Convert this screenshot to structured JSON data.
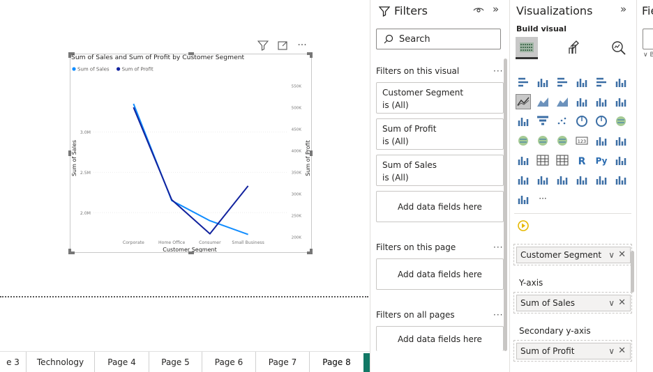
{
  "canvas": {
    "visual": {
      "title": "Sum of Sales and Sum of Profit by Customer Segment",
      "header_icons": [
        "filter-icon",
        "focus-mode-icon",
        "more-options-icon"
      ],
      "more_label": "···"
    }
  },
  "chart_data": {
    "type": "line",
    "title": "Sum of Sales and Sum of Profit by Customer Segment",
    "categories": [
      "Corporate",
      "Home Office",
      "Consumer",
      "Small Business"
    ],
    "xlabel": "Customer Segment",
    "ylabel": "Sum of Sales",
    "y2label": "Sum of Profit",
    "y_ticks": [
      "2.0M",
      "2.5M",
      "3.0M"
    ],
    "y2_ticks": [
      "200K",
      "250K",
      "300K",
      "350K",
      "400K",
      "450K",
      "500K",
      "550K"
    ],
    "ylim": [
      1700000,
      3600000
    ],
    "y2lim": [
      200000,
      555000
    ],
    "legend_position": "top-left",
    "series": [
      {
        "name": "Sum of Sales",
        "axis": "primary",
        "color": "#118dff",
        "values": [
          3350000,
          2150000,
          1900000,
          1730000
        ]
      },
      {
        "name": "Sum of Profit",
        "axis": "secondary",
        "color": "#12239e",
        "values": [
          500000,
          286000,
          207000,
          318000
        ]
      }
    ]
  },
  "tabs": {
    "items": [
      "e 3",
      "Technology",
      "Page 4",
      "Page 5",
      "Page 6",
      "Page 7",
      "Page 8"
    ],
    "active": "Page 8",
    "add_label": "+"
  },
  "filters": {
    "title": "Filters",
    "search_placeholder": "Search",
    "on_visual_label": "Filters on this visual",
    "on_page_label": "Filters on this page",
    "on_all_label": "Filters on all pages",
    "dots": "···",
    "cards": [
      {
        "name": "Customer Segment",
        "state": "is (All)"
      },
      {
        "name": "Sum of Profit",
        "state": "is (All)"
      },
      {
        "name": "Sum of Sales",
        "state": "is (All)"
      }
    ],
    "add_fields_label": "Add data fields here"
  },
  "visualizations": {
    "title": "Visualizations",
    "build_visual_label": "Build visual",
    "tab_icons": [
      "build-visual-icon",
      "format-visual-icon",
      "analytics-icon"
    ],
    "more_visuals": "···",
    "wells": [
      {
        "label": "",
        "field": "Customer Segment"
      },
      {
        "label": "Y-axis",
        "field": "Sum of Sales"
      },
      {
        "label": "Secondary y-axis",
        "field": "Sum of Profit"
      }
    ],
    "chevron": "∨",
    "remove": "✕"
  },
  "fields": {
    "title": "Fie",
    "tree_label": "∨ B"
  },
  "colors": {
    "accent_green": "#117865",
    "sales_series": "#118dff",
    "profit_series": "#12239e"
  }
}
